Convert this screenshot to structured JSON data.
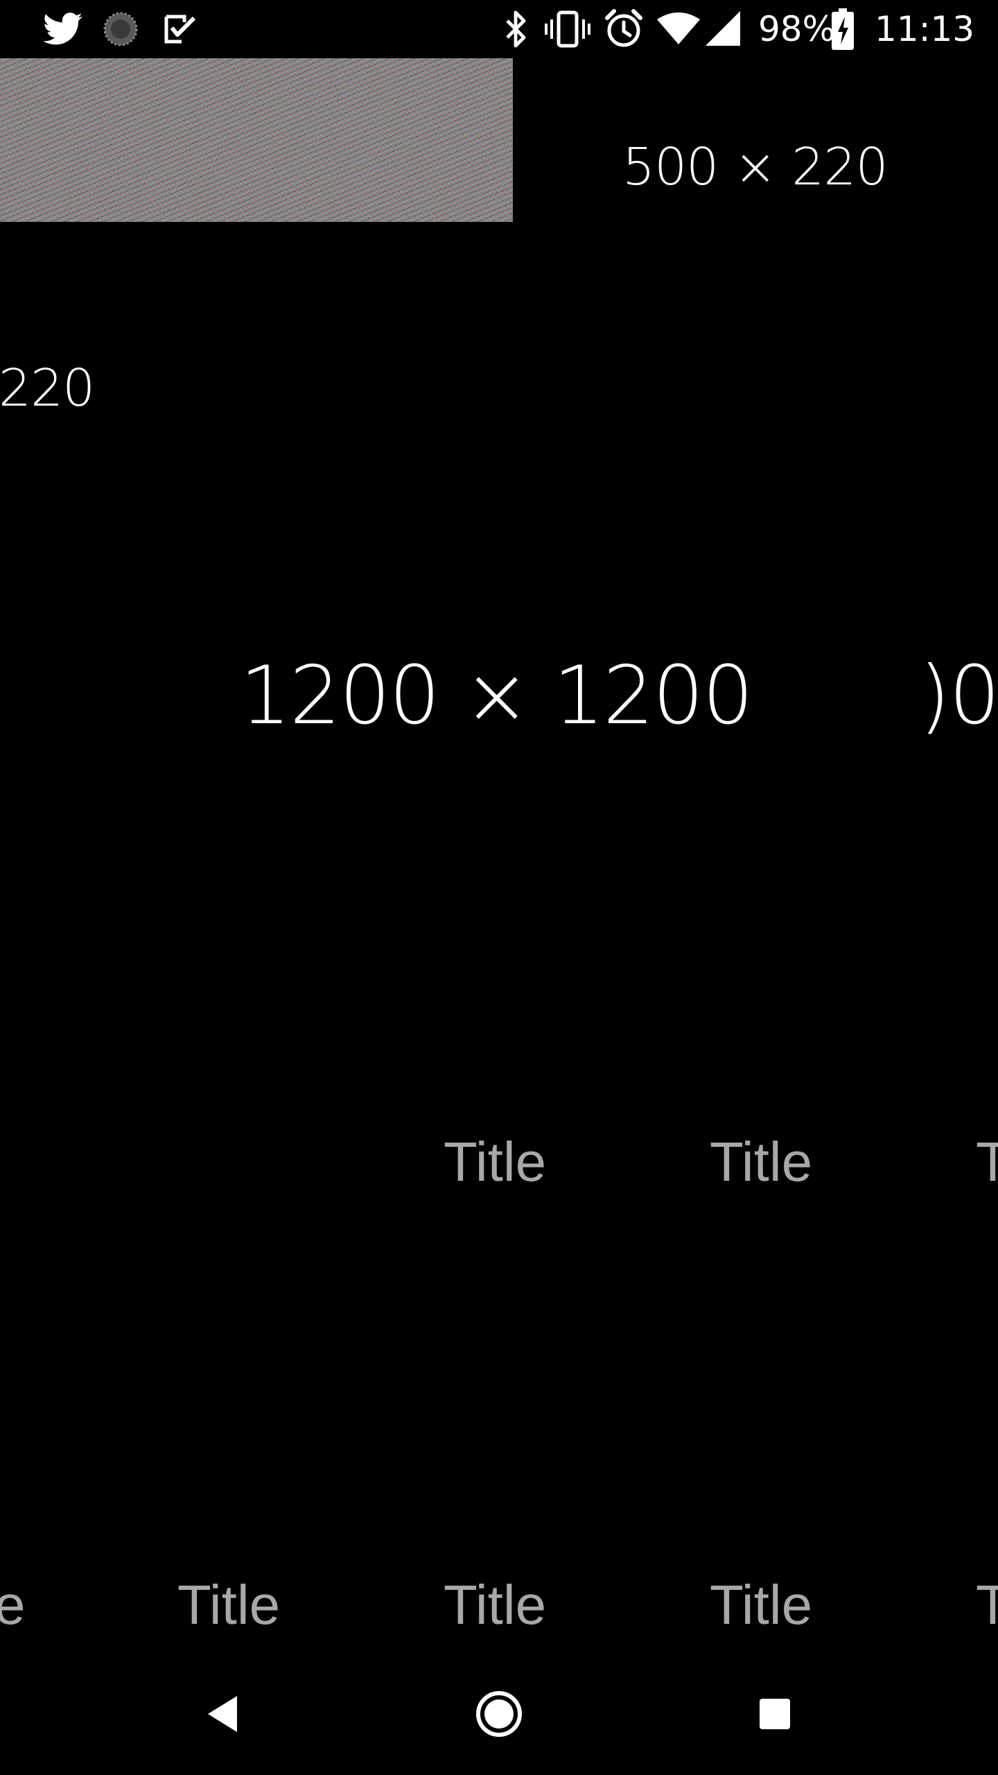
{
  "status_bar": {
    "left_icons": [
      "twitter-icon",
      "loading-circle-icon",
      "tasks-icon"
    ],
    "right_icons": [
      "bluetooth-icon",
      "vibrate-icon",
      "alarm-icon",
      "wifi-icon",
      "cell-signal-icon",
      "battery-charging-icon"
    ],
    "battery": "98%",
    "time": "11:13"
  },
  "content": {
    "banner_size_label": "500 × 220",
    "partial_size_label": "220",
    "main_size_label": "1200 × 1200",
    "partial_main_label": ")0",
    "title_row_1": [
      "Title",
      "Title",
      "T"
    ],
    "title_row_2": [
      "e",
      "Title",
      "Title",
      "Title",
      "T"
    ]
  },
  "navigation": {
    "icons": [
      "back-icon",
      "home-icon",
      "recents-icon"
    ]
  },
  "colors": {
    "background": "#000000",
    "primary_text": "#ffffff",
    "title_text": "#a8a8a8"
  }
}
